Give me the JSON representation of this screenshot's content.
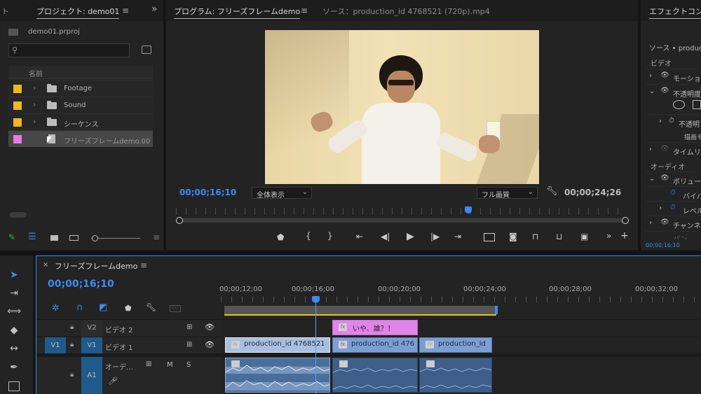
{
  "project_panel": {
    "tab_prev": "ト",
    "tab_title": "プロジェクト: demo01",
    "menu": "≡",
    "overflow": "»",
    "project_file": "demo01.prproj",
    "search_placeholder": "",
    "column_name": "名前",
    "items": [
      {
        "label": "Footage",
        "color": "#f0b820",
        "type": "folder"
      },
      {
        "label": "Sound",
        "color": "#f0b820",
        "type": "folder"
      },
      {
        "label": "シーケンス",
        "color": "#f0b820",
        "type": "folder"
      },
      {
        "label": "フリーズフレームdemo.00",
        "color": "#e27ce6",
        "type": "sequence"
      }
    ]
  },
  "program_monitor": {
    "tab_title": "プログラム: フリーズフレームdemo",
    "menu": "≡",
    "source_tab": "ソース：production_id 4768521 (720p).mp4",
    "timecode_current": "00;00;16;10",
    "zoom_select": "全体表示",
    "quality_select": "フル画質",
    "timecode_duration": "00;00;24;26",
    "playhead_fraction": 0.65,
    "controls": [
      "marker-icon",
      "in-point-icon",
      "out-point-icon",
      "go-to-in-icon",
      "step-back-icon",
      "play-icon",
      "step-forward-icon",
      "go-to-out-icon",
      "safe-margins-icon",
      "camera-icon",
      "insert-icon",
      "overwrite-icon",
      "multi-camera-icon",
      "more-icon",
      "add-icon"
    ]
  },
  "effect_controls": {
    "tab_title": "エフェクトコン",
    "source_line": "ソース • product",
    "video_header": "ビデオ",
    "rows": [
      "モーショ",
      "不透明度",
      "不透明",
      "描画モ",
      "タイムリ"
    ],
    "audio_header": "オーディオ",
    "audio_rows": [
      "ボリュー",
      "バイパ",
      "レベル",
      "チャンネ",
      "パン"
    ],
    "timecode": "00;00;16;10"
  },
  "tools": [
    "selection-tool-icon",
    "track-select-tool-icon",
    "ripple-edit-tool-icon",
    "razor-tool-icon",
    "slip-tool-icon",
    "pen-tool-icon",
    "rectangle-tool-icon"
  ],
  "timeline": {
    "close": "×",
    "tab_title": "フリーズフレームdemo",
    "menu": "≡",
    "timecode": "00;00;16;10",
    "ruler_labels": [
      "00;00;12;00",
      "00;00;16;00",
      "00;00;20;00",
      "00;00;24;00",
      "00;00;28;00",
      "00;00;32;00"
    ],
    "tracks": {
      "v2": {
        "name": "V2",
        "label": "ビデオ 2"
      },
      "v1": {
        "name": "V1",
        "source": "V1",
        "label": "ビデオ 1"
      },
      "a1": {
        "name": "A1",
        "label": "オーデ…",
        "mute": "M",
        "solo": "S"
      }
    },
    "clips": {
      "title_clip": "いや、誰？！",
      "v1_clips": [
        "production_id 4768521",
        "production_id 476",
        "production_id"
      ]
    }
  }
}
